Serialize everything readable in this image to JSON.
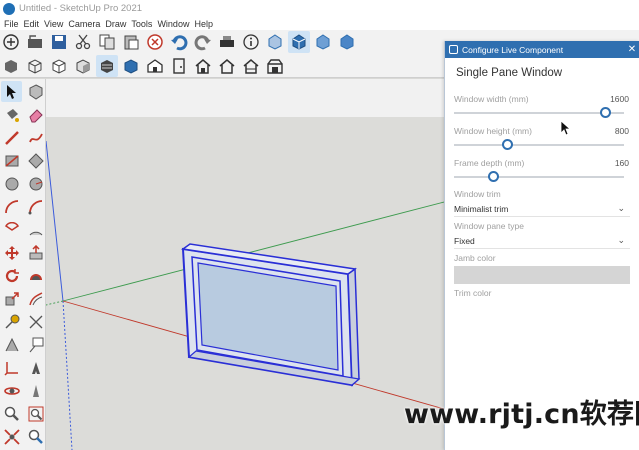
{
  "window": {
    "title": "Untitled - SketchUp Pro 2021"
  },
  "menu": [
    "File",
    "Edit",
    "View",
    "Camera",
    "Draw",
    "Tools",
    "Window",
    "Help"
  ],
  "toolbar_row1": [
    "new-icon",
    "open-icon",
    "save-icon",
    "cut-icon",
    "copy-icon",
    "paste-icon",
    "erase-icon",
    "undo-icon",
    "redo-icon",
    "print-icon",
    "model-info-icon",
    "view-top-icon",
    "view-iso-icon",
    "view-front-icon",
    "view-right-icon"
  ],
  "toolbar_row2": [
    "xray-icon",
    "wireframe-icon",
    "hidden-line-icon",
    "shaded-icon",
    "shaded-textures-icon",
    "monochrome-icon",
    "section-icon",
    "door-icon",
    "house-icon",
    "house-outline-icon",
    "house2-icon",
    "warehouse-icon"
  ],
  "left_tools": [
    "select-icon",
    "make-component-icon",
    "paint-bucket-icon",
    "eraser-icon",
    "line-icon",
    "freehand-icon",
    "rectangle-icon",
    "rotated-rectangle-icon",
    "circle-icon",
    "polygon-icon",
    "arc-icon",
    "arc2-icon",
    "pie-icon",
    "arc3-icon",
    "move-icon",
    "push-pull-icon",
    "rotate-icon",
    "follow-me-icon",
    "scale-icon",
    "offset-icon",
    "tape-measure-icon",
    "dimension-icon",
    "protractor-icon",
    "text-icon",
    "axes-icon",
    "3d-text-icon",
    "orbit-icon",
    "walk-icon",
    "zoom-icon",
    "zoom-window-icon",
    "zoom-extents-icon",
    "position-camera-icon"
  ],
  "panel": {
    "header": "Configure Live Component",
    "component_name": "Single Pane Window",
    "fields": [
      {
        "label": "Window width (mm)",
        "value": "1600",
        "fraction": 0.86
      },
      {
        "label": "Window height (mm)",
        "value": "800",
        "fraction": 0.3
      },
      {
        "label": "Frame depth (mm)",
        "value": "160",
        "fraction": 0.22
      }
    ],
    "selects": [
      {
        "label": "Window trim",
        "value": "Minimalist trim"
      },
      {
        "label": "Window pane type",
        "value": "Fixed"
      }
    ],
    "colors": [
      {
        "label": "Jamb color",
        "color": "#d5d5d5"
      },
      {
        "label": "Trim color",
        "color": ""
      }
    ],
    "accent": "#2f6fb0"
  },
  "watermark": "www.rjtj.cn软荐网"
}
